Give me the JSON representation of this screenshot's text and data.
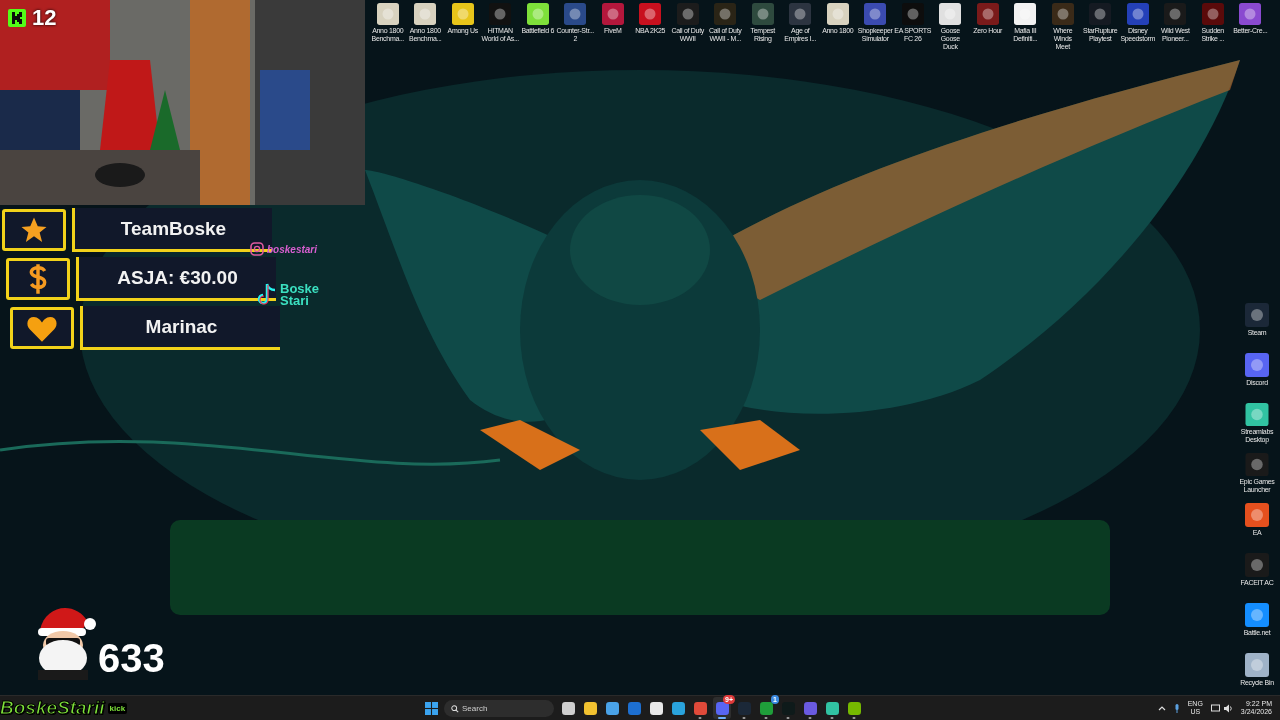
{
  "overlay": {
    "viewer_count": "12",
    "alerts": [
      {
        "kind": "star",
        "text": "TeamBoske"
      },
      {
        "kind": "dollar",
        "text": "ASJA: €30.00"
      },
      {
        "kind": "heart",
        "text": "Marinac"
      }
    ],
    "socials": [
      {
        "kind": "instagram",
        "handle": "boskestari"
      },
      {
        "kind": "tiktok",
        "handle": "Boske\nStari"
      }
    ],
    "counter": "633",
    "channel_name": "BoskeStarii",
    "platform_badge": "kick"
  },
  "desktop_top": [
    {
      "label": "Anno 1800\nBenchma...",
      "color": "#d8d2bf"
    },
    {
      "label": "Anno 1800\nBenchma...",
      "color": "#d8d2bf"
    },
    {
      "label": "Among Us",
      "color": "#e8c51a"
    },
    {
      "label": "HITMAN\nWorld of As...",
      "color": "#111111"
    },
    {
      "label": "Battlefield 6",
      "color": "#7ee03a"
    },
    {
      "label": "Counter-Str...\n2",
      "color": "#2a4a8a"
    },
    {
      "label": "FiveM",
      "color": "#b3173c"
    },
    {
      "label": "NBA 2K25",
      "color": "#c8101e"
    },
    {
      "label": "Call of Duty\nWWII",
      "color": "#1c1c1c"
    },
    {
      "label": "Call of Duty\nWWII - M...",
      "color": "#2a2416"
    },
    {
      "label": "Tempest\nRising",
      "color": "#2e4a3e"
    },
    {
      "label": "Age of\nEmpires I...",
      "color": "#2c3440"
    },
    {
      "label": "Anno 1800",
      "color": "#d8d2bf"
    },
    {
      "label": "Shopkeeper\nSimulator",
      "color": "#3b4bb0"
    },
    {
      "label": "EA SPORTS\nFC 26",
      "color": "#0d0d0d"
    },
    {
      "label": "Goose Goose\nDuck",
      "color": "#e0e0e0"
    },
    {
      "label": "Zero Hour",
      "color": "#7a1a1a"
    },
    {
      "label": "Mafia III\nDefiniti...",
      "color": "#f2f2f2"
    },
    {
      "label": "Where Winds\nMeet",
      "color": "#3a2a18"
    },
    {
      "label": "StarRupture\nPlaytest",
      "color": "#151a22"
    },
    {
      "label": "Disney\nSpeedstorm",
      "color": "#2440b8"
    },
    {
      "label": "Wild West\nPioneer...",
      "color": "#1a1a1a"
    },
    {
      "label": "Sudden\nStrike ...",
      "color": "#5a0a0a"
    },
    {
      "label": "Better-Cre...",
      "color": "#8a4ad0"
    }
  ],
  "desktop_right": [
    {
      "label": "Steam",
      "color": "#1b2838"
    },
    {
      "label": "Discord",
      "color": "#5865f2"
    },
    {
      "label": "Streamlabs\nDesktop",
      "color": "#31c3a2"
    },
    {
      "label": "Epic Games\nLauncher",
      "color": "#1a1a1a"
    },
    {
      "label": "EA",
      "color": "#e5501e"
    },
    {
      "label": "FACEIT AC",
      "color": "#1a1a1a"
    },
    {
      "label": "Battle.net",
      "color": "#148eff"
    },
    {
      "label": "Recycle Bin",
      "color": "#9fb3c8"
    }
  ],
  "taskbar": {
    "search": {
      "placeholder": "Search"
    },
    "apps": [
      {
        "color": "#cfcfcf",
        "open": false,
        "focused": false
      },
      {
        "color": "#f2c230",
        "open": false,
        "focused": false
      },
      {
        "color": "#4aa3e8",
        "open": false,
        "focused": false
      },
      {
        "color": "#1d6fd0",
        "open": false,
        "focused": false
      },
      {
        "color": "#e8e8e8",
        "open": false,
        "focused": false
      },
      {
        "color": "#2aa3dc",
        "open": false,
        "focused": false
      },
      {
        "color": "#e04a3a",
        "open": true,
        "focused": false
      },
      {
        "color": "#5865f2",
        "open": true,
        "focused": true,
        "badge": "9+"
      },
      {
        "color": "#1b2838",
        "open": true,
        "focused": false
      },
      {
        "color": "#1f9e3a",
        "open": true,
        "focused": false,
        "badge": "1"
      },
      {
        "color": "#0e1a1a",
        "open": true,
        "focused": false
      },
      {
        "color": "#6a5ae0",
        "open": true,
        "focused": false
      },
      {
        "color": "#31c3a2",
        "open": true,
        "focused": false
      },
      {
        "color": "#76b900",
        "open": true,
        "focused": false
      }
    ],
    "language": "ENG",
    "region": "US",
    "time": "9:22 PM",
    "date": "3/24/2026"
  }
}
